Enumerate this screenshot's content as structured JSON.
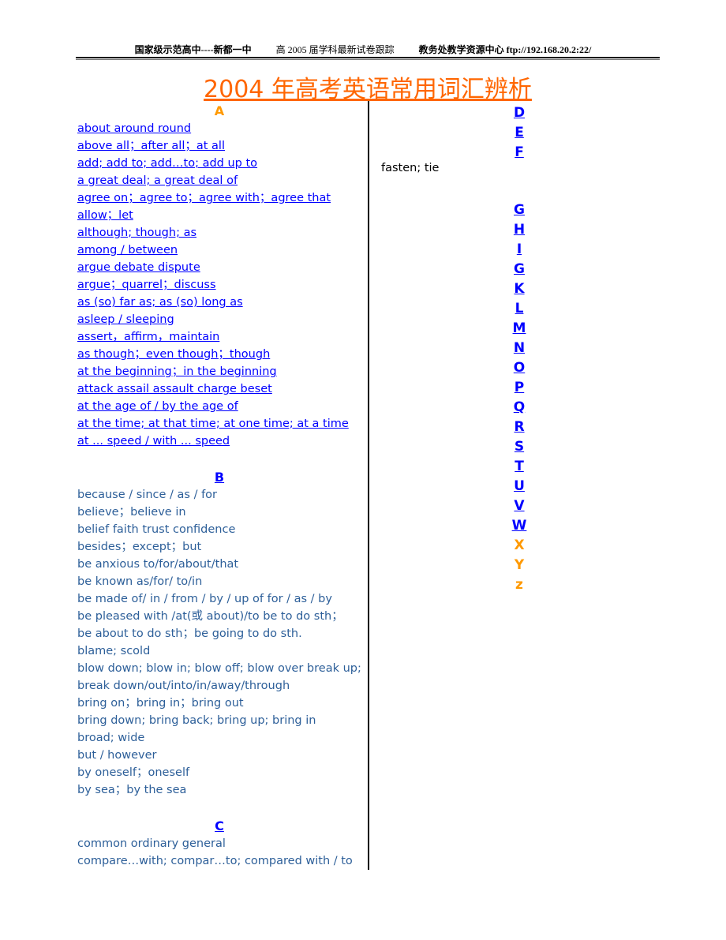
{
  "header": {
    "school": "国家级示范高中----新都一中",
    "subject": "高 2005 届学科最新试卷跟踪",
    "center": "教务处教学资源中心 ftp://192.168.20.2:22/"
  },
  "title": "2004 年高考英语常用词汇辨析",
  "colors": {
    "title": "#ff6600",
    "orange_letter": "#ff9900",
    "link": "#0000ff",
    "plain_text": "#2d5f99"
  },
  "sections": {
    "a": {
      "heading": "A",
      "items": [
        "about  around  round",
        "above all；after all；at all",
        "add; add to; add…to; add up to",
        "a great deal; a great deal of",
        "agree on；agree to；agree with；agree that",
        "allow；let",
        "although; though; as",
        "among / between ",
        "argue  debate  dispute",
        "argue；quarrel；discuss",
        "as (so) far as; as (so) long as",
        "asleep / sleeping",
        "assert，affirm，maintain",
        "as though；even though；though",
        "at the beginning；in the beginning",
        "attack  assail  assault  charge  beset",
        "at the age of / by the age of",
        "at the time; at that time; at one time; at a time",
        "at ...  speed  /  with ...  speed"
      ]
    },
    "b": {
      "heading": "B",
      "items": [
        "because / since / as / for",
        "believe；believe in",
        "belief  faith trust  confidence",
        "besides；except；but",
        "be anxious to/for/about/that",
        "be known as/for/ to/in",
        "be made of/ in / from / by / up of for / as / by",
        "be pleased with /at(或 about)/to be to do sth；",
        "be about to do sth；be going to do sth.",
        "blame; scold",
        "blow down; blow in; blow off; blow over break up;",
        "break down/out/into/in/away/through",
        "bring on；bring in；bring out",
        "bring down; bring back; bring up; bring in",
        "broad; wide",
        "but / however",
        "by oneself；oneself",
        "by sea；by the sea"
      ]
    },
    "c": {
      "heading": "C",
      "items": [
        "common ordinary general",
        "compare…with; compar…to; compared with / to"
      ]
    }
  },
  "right_column": {
    "letters_top": [
      "D",
      "E",
      "F"
    ],
    "f_item": "fasten; tie",
    "letters_links": [
      "G",
      "H",
      "I",
      "G",
      "K",
      "L",
      "M",
      "N",
      "O",
      "P",
      "Q",
      "R",
      "S",
      "T",
      "U",
      "V",
      "W"
    ],
    "letters_plain": [
      "X",
      "Y",
      "z"
    ]
  }
}
